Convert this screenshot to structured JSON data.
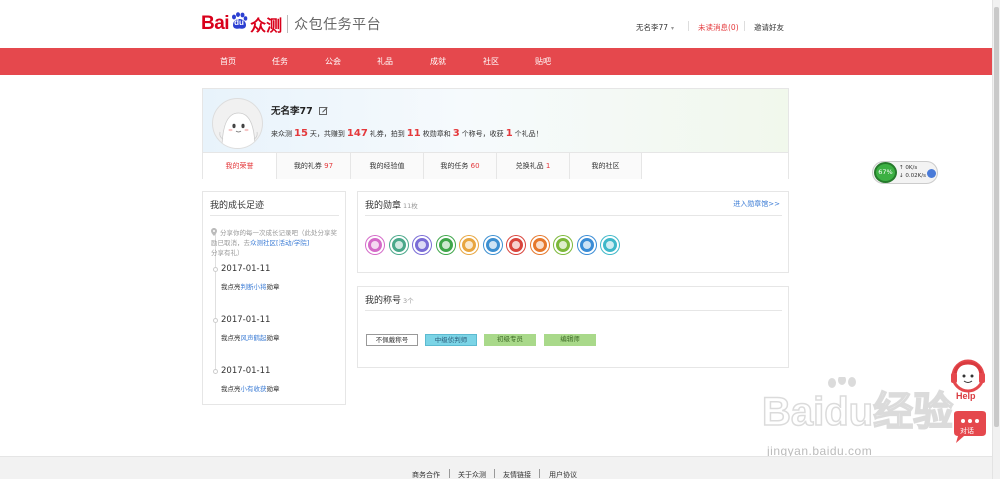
{
  "header": {
    "logo_bai": "Bai",
    "logo_du": "du",
    "logo_zc": "众测",
    "platform": "众包任务平台",
    "username": "无名李77",
    "unread": "未读消息(0)",
    "invite": "邀请好友"
  },
  "nav": {
    "items": [
      "首页",
      "任务",
      "公会",
      "礼品",
      "成就",
      "社区",
      "贴吧"
    ]
  },
  "profile": {
    "name": "无名李77",
    "stats": {
      "t1": "来众测",
      "days": "15",
      "t2": "天，共赚到",
      "coupons": "147",
      "t3": "礼券，拍到",
      "medals": "11",
      "t4": "枚勋章和",
      "titles": "3",
      "t5": "个称号，收获",
      "gifts": "1",
      "t6": "个礼品！"
    },
    "tabs": [
      {
        "label": "我的荣誉",
        "count": ""
      },
      {
        "label": "我的礼券 ",
        "count": "97"
      },
      {
        "label": "我的经验值",
        "count": ""
      },
      {
        "label": "我的任务 ",
        "count": "60"
      },
      {
        "label": "兑换礼品 ",
        "count": "1"
      },
      {
        "label": "我的社区",
        "count": ""
      }
    ]
  },
  "growth": {
    "title": "我的成长足迹",
    "intro_a": "分享你的每一次成长记录吧（此处分享奖励已取消，去",
    "intro_link": "众测社区[活动/学院]",
    "intro_b": "分享有礼）",
    "items": [
      {
        "date": "2017-01-11",
        "pre": "我点亮",
        "link": "判断小将",
        "post": "勋章"
      },
      {
        "date": "2017-01-11",
        "pre": "我点亮",
        "link": "风声鹤起",
        "post": "勋章"
      },
      {
        "date": "2017-01-11",
        "pre": "我点亮",
        "link": "小有收获",
        "post": "勋章"
      }
    ]
  },
  "medals": {
    "title": "我的勋章",
    "count": "11枚",
    "more": "进入勋章馆>>",
    "icons": [
      {
        "name": "paper-plane-medal-icon",
        "color": "#d46ac8"
      },
      {
        "name": "chair-medal-icon",
        "color": "#4aa88a"
      },
      {
        "name": "wrench-medal-icon",
        "color": "#7a6cd6"
      },
      {
        "name": "frog-medal-icon",
        "color": "#3fa64a"
      },
      {
        "name": "face-medal-icon",
        "color": "#e8a640"
      },
      {
        "name": "person-medal-icon",
        "color": "#3c8fd1"
      },
      {
        "name": "wave-medal-icon",
        "color": "#d9443c"
      },
      {
        "name": "people-medal-icon",
        "color": "#e6782c"
      },
      {
        "name": "leaf-medal-icon",
        "color": "#7cb83a"
      },
      {
        "name": "gun-medal-icon",
        "color": "#3a8cd6"
      },
      {
        "name": "bag-medal-icon",
        "color": "#3fb8c9"
      }
    ]
  },
  "titles": {
    "title": "我的称号",
    "count": "3个",
    "tags": [
      "不佩戴称号",
      "中级侦判师",
      "初级专员",
      "编辑师"
    ]
  },
  "widgets": {
    "speed_pct": "67%",
    "speed_up": "0K/s",
    "speed_down": "0.02K/s",
    "help": "Help",
    "chat": "对话"
  },
  "watermark": {
    "brand": "Baidu经验",
    "url": "jingyan.baidu.com"
  },
  "footer": {
    "links": [
      "商务合作",
      "关于众测",
      "友情链接",
      "用户协议"
    ]
  }
}
